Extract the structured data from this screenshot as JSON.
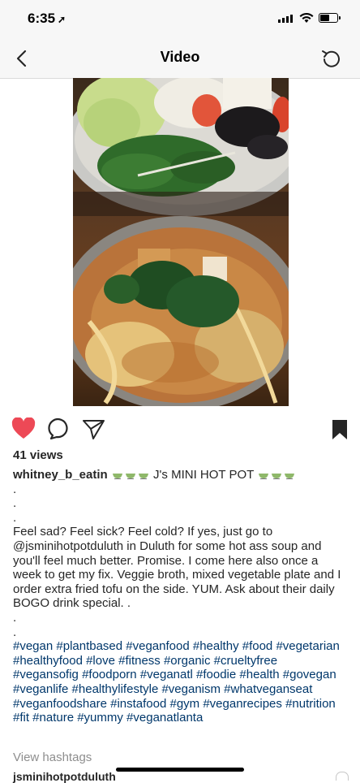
{
  "status_bar": {
    "time": "6:35"
  },
  "nav": {
    "title": "Video"
  },
  "post": {
    "views": "41 views",
    "username": "whitney_b_eatin",
    "caption_title": "J's MINI HOT POT",
    "dots_top": [
      ".",
      ".",
      "."
    ],
    "body": "Feel sad? Feel sick? Feel cold? If yes, just go to @jsminihotpotduluth in Duluth for some hot ass soup and you'll feel much better. Promise. I come here also once a week to get my fix. Veggie broth, mixed vegetable plate and I order extra fried tofu on the side. YUM. Ask about their daily BOGO drink special. .",
    "dots_bottom": [
      ".",
      "."
    ],
    "hashtags": "#vegan #plantbased #veganfood #healthy #food #vegetarian #healthyfood #love #fitness #organic #crueltyfree #vegansofig #foodporn #veganatl #foodie #health #govegan #veganlife #healthylifestyle #veganism #whatveganseat #veganfoodshare #instafood #gym #veganrecipes #nutrition #fit #nature #yummy #veganatlanta",
    "view_hashtags": "View hashtags",
    "next_comment_user": "jsminihotpotduluth"
  },
  "colors": {
    "like_red": "#ed4956",
    "hashtag_blue": "#00376b",
    "muted_gray": "#8e8e8e"
  }
}
